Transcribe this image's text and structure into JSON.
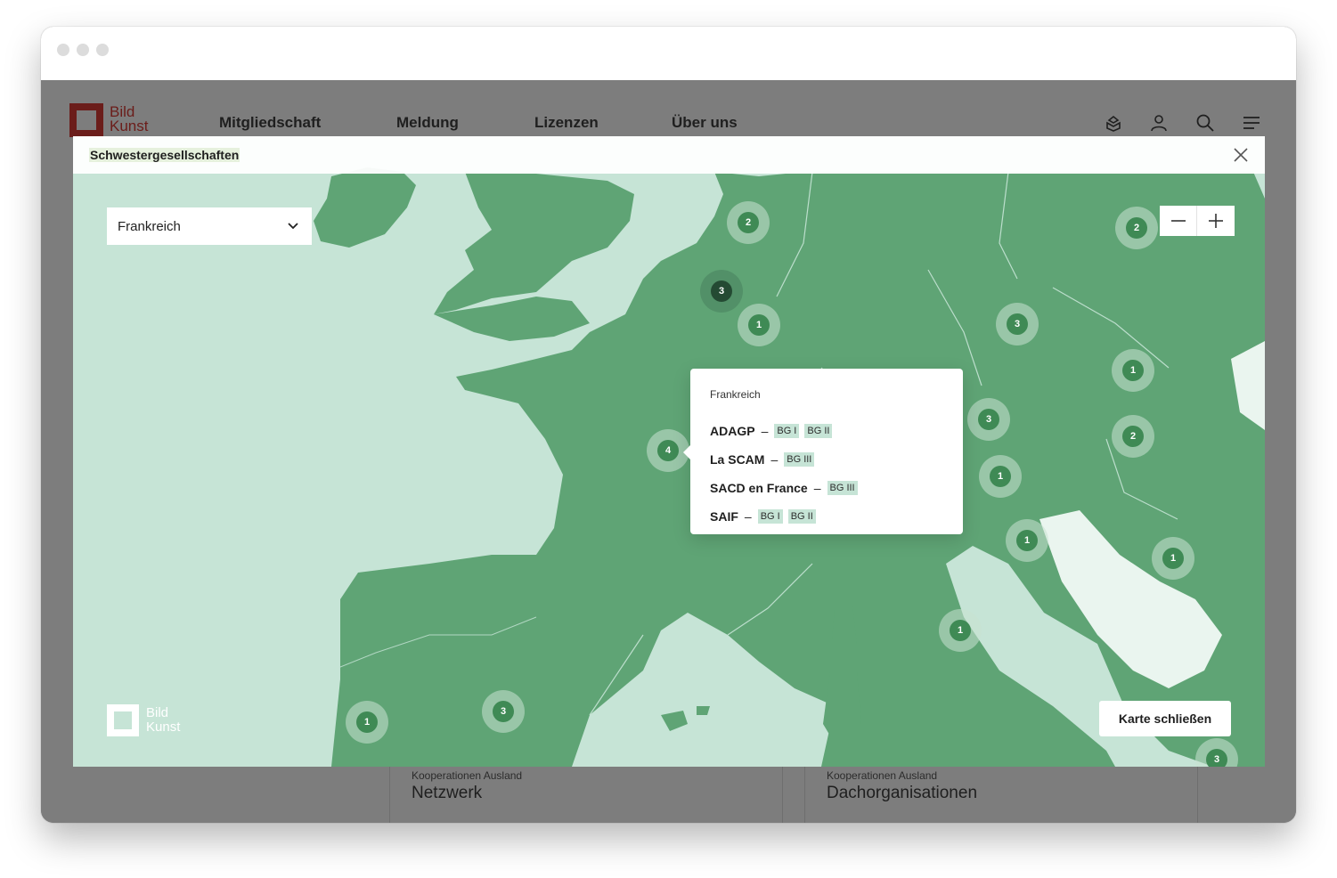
{
  "site": {
    "logo": {
      "line1": "Bild",
      "line2": "Kunst"
    },
    "nav": [
      "Mitgliedschaft",
      "Meldung",
      "Lizenzen",
      "Über uns"
    ],
    "icons": [
      "ship-icon",
      "user-icon",
      "search-icon",
      "menu-icon"
    ],
    "cards": [
      {
        "kicker": "Kooperationen Ausland",
        "title": "Netzwerk"
      },
      {
        "kicker": "Kooperationen Ausland",
        "title": "Dachorganisationen"
      }
    ]
  },
  "modal": {
    "title": "Schwestergesellschaften",
    "select_value": "Frankreich",
    "close_button": "Karte schließen",
    "logo": {
      "line1": "Bild",
      "line2": "Kunst"
    },
    "clusters": [
      "2",
      "2",
      "3",
      "1",
      "3",
      "4",
      "3",
      "1",
      "1",
      "2",
      "1",
      "1",
      "1",
      "1",
      "3",
      "3"
    ],
    "popup": {
      "country": "Frankreich",
      "societies": [
        {
          "name": "ADAGP",
          "tags": [
            "BG I",
            "BG II"
          ]
        },
        {
          "name": "La SCAM",
          "tags": [
            "BG III"
          ]
        },
        {
          "name": "SACD en France",
          "tags": [
            "BG III"
          ]
        },
        {
          "name": "SAIF",
          "tags": [
            "BG I",
            "BG II"
          ]
        }
      ]
    }
  },
  "colors": {
    "land": "#5fa475",
    "sea": "#c6e4d6",
    "cluster": "#3f8a55",
    "brand": "#6b1d1a"
  }
}
